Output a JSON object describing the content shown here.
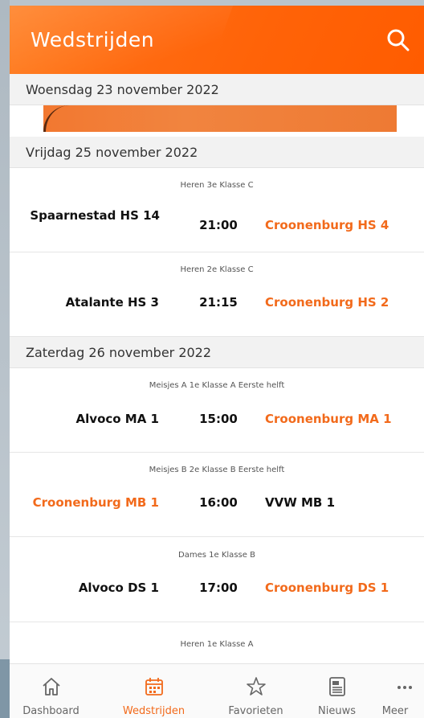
{
  "header": {
    "title": "Wedstrijden"
  },
  "days": [
    {
      "date": "Woensdag 23 november 2022"
    },
    {
      "date": "Vrijdag 25 november 2022"
    },
    {
      "date": "Zaterdag 26 november 2022"
    }
  ],
  "matches": [
    {
      "league": "Heren 3e Klasse C",
      "home": "Spaarnestad HS 14",
      "time": "21:00",
      "away": "Croonenburg HS 4"
    },
    {
      "league": "Heren 2e Klasse C",
      "home": "Atalante HS 3",
      "time": "21:15",
      "away": "Croonenburg HS 2"
    },
    {
      "league": "Meisjes A 1e Klasse A Eerste helft",
      "home": "Alvoco MA 1",
      "time": "15:00",
      "away": "Croonenburg MA 1"
    },
    {
      "league": "Meisjes B 2e Klasse B Eerste helft",
      "home": "Croonenburg MB 1",
      "time": "16:00",
      "away": "VVW MB 1"
    },
    {
      "league": "Dames 1e Klasse B",
      "home": "Alvoco DS 1",
      "time": "17:00",
      "away": "Croonenburg DS 1"
    },
    {
      "league": "Heren 1e Klasse A"
    }
  ],
  "tabs": [
    {
      "label": "Dashboard",
      "icon": "home-icon"
    },
    {
      "label": "Wedstrijden",
      "icon": "calendar-icon",
      "active": true
    },
    {
      "label": "Favorieten",
      "icon": "star-icon"
    },
    {
      "label": "Nieuws",
      "icon": "news-icon"
    },
    {
      "label": "Meer",
      "icon": "more-icon"
    }
  ],
  "colors": {
    "accent": "#f26a1b",
    "header": "#ff6308"
  }
}
